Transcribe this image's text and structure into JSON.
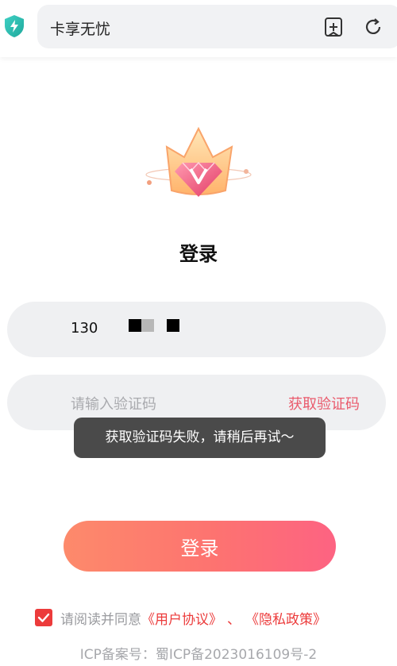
{
  "browser": {
    "url_title": "卡享无忧",
    "icons": [
      "shield-icon",
      "add-bookmark-icon",
      "refresh-icon"
    ]
  },
  "page": {
    "title": "登录",
    "phone": {
      "value": "130"
    },
    "code": {
      "placeholder": "请输入验证码",
      "get_code_label": "获取验证码"
    },
    "toast": "获取验证码失败，请稍后再试～",
    "login_label": "登录",
    "agreement": {
      "checked": true,
      "prefix": "请阅读并同意",
      "user_agreement": "《用户协议》",
      "separator": "、",
      "privacy_policy": "《隐私政策》"
    },
    "icp": "ICP备案号：蜀ICP备2023016109号-2"
  },
  "colors": {
    "accent": "#ea5a6c",
    "checkbox": "#ec3b3b",
    "button_gradient_start": "#fd8a6b",
    "button_gradient_end": "#fd6382",
    "toast_bg": "#4a4a4a"
  }
}
